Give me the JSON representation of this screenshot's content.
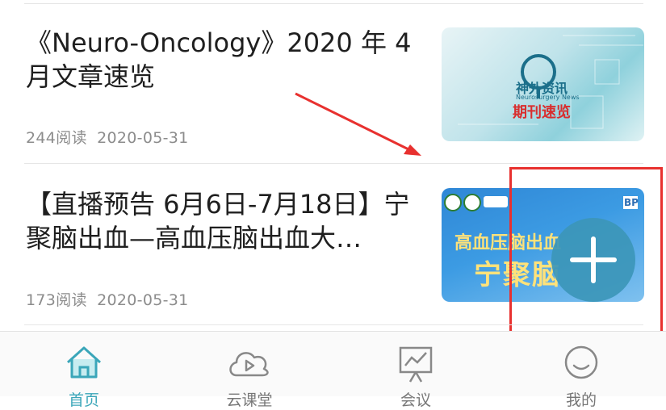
{
  "articles": [
    {
      "title": "《Neuro-Oncology》2020 年 4 月文章速览",
      "reads": "244阅读",
      "date": "2020-05-31",
      "thumb_text_1": "神外资讯",
      "thumb_text_2": "Neurosurgery News",
      "thumb_text_3": "期刊速览"
    },
    {
      "title": "【直播预告 6月6日-7月18日】宁聚脑出血—高血压脑出血大…",
      "reads": "173阅读",
      "date": "2020-05-31",
      "thumb_text_1": "高血压脑出血",
      "thumb_text_2": "宁聚脑",
      "thumb_text_3": "BP"
    }
  ],
  "tabs": [
    {
      "label": "首页",
      "icon": "home-icon",
      "active": true
    },
    {
      "label": "云课堂",
      "icon": "cloud-play-icon",
      "active": false
    },
    {
      "label": "会议",
      "icon": "meeting-chart-icon",
      "active": false
    },
    {
      "label": "我的",
      "icon": "smile-icon",
      "active": false
    }
  ],
  "colors": {
    "accent": "#3aa6b9",
    "annotation_red": "#e8312f",
    "fab": "#3c96b9"
  }
}
